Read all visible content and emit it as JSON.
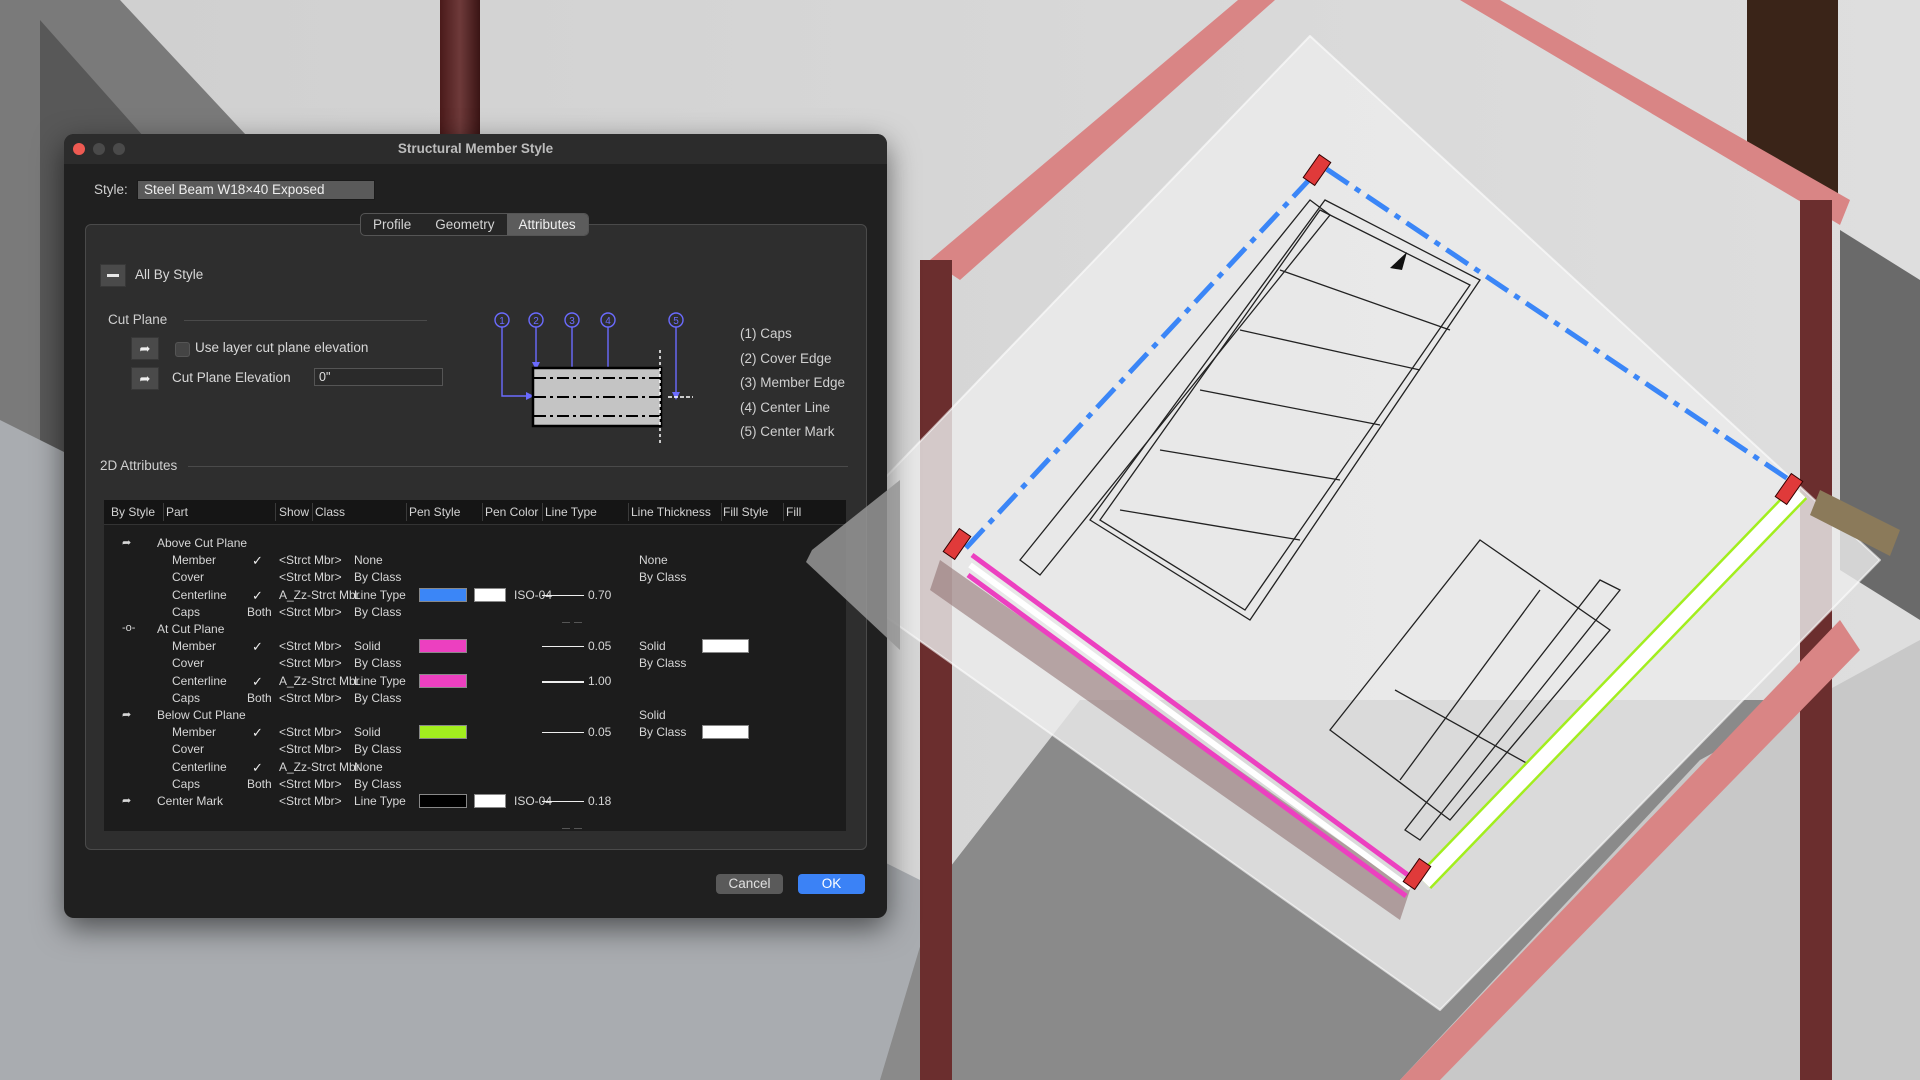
{
  "window": {
    "title": "Structural Member Style"
  },
  "style_field": {
    "label": "Style:",
    "value": "Steel Beam W18×40 Exposed"
  },
  "tabs": [
    {
      "label": "Profile",
      "active": false
    },
    {
      "label": "Geometry",
      "active": false
    },
    {
      "label": "Attributes",
      "active": true
    }
  ],
  "all_by_style": {
    "label": "All By Style"
  },
  "cut_plane": {
    "section_label": "Cut Plane",
    "use_layer_label": "Use layer cut plane elevation",
    "use_layer_checked": false,
    "elevation_label": "Cut Plane Elevation",
    "elevation_value": "0\""
  },
  "diagram": {
    "callouts": [
      "1",
      "2",
      "3",
      "4",
      "5"
    ],
    "legend": [
      "(1) Caps",
      "(2) Cover Edge",
      "(3) Member Edge",
      "(4) Center Line",
      "(5) Center Mark"
    ],
    "accent_color": "#6b6bff"
  },
  "attributes_2d": {
    "section_label": "2D Attributes",
    "columns": [
      "By Style",
      "Part",
      "Show",
      "Class",
      "Pen Style",
      "Pen Color",
      "Line Type",
      "Line Thickness",
      "Fill Style",
      "Fill"
    ],
    "rows": [
      {
        "by_style_icon": "by-style-icon",
        "part": "Above Cut Plane",
        "indent": false,
        "show": "",
        "class": "",
        "pen_style": "",
        "pen_color": "",
        "line_type_swatch": "",
        "line_type": "",
        "thickness": "",
        "fill_style": "",
        "fill": ""
      },
      {
        "by_style_icon": "",
        "part": "Member",
        "indent": true,
        "show": "✓",
        "class": "<Strct Mbr>",
        "pen_style": "None",
        "pen_color": "",
        "line_type_swatch": "",
        "line_type": "",
        "thickness": "",
        "fill_style": "None",
        "fill": ""
      },
      {
        "by_style_icon": "",
        "part": "Cover",
        "indent": true,
        "show": "",
        "class": "<Strct Mbr>",
        "pen_style": "By Class",
        "pen_color": "",
        "line_type_swatch": "",
        "line_type": "",
        "thickness": "",
        "fill_style": "By Class",
        "fill": ""
      },
      {
        "by_style_icon": "",
        "part": "Centerline",
        "indent": true,
        "show": "✓",
        "class": "A_Zz-Strct Mbr",
        "pen_style": "Line Type",
        "pen_color": "#3b86f7",
        "line_type_swatch": "#ffffff",
        "line_type": "ISO-04",
        "thickness": "0.70",
        "fill_style": "",
        "fill": ""
      },
      {
        "by_style_icon": "",
        "part": "Caps",
        "indent": true,
        "show": "Both",
        "class": "<Strct Mbr>",
        "pen_style": "By Class",
        "pen_color": "",
        "line_type_swatch": "",
        "line_type": "",
        "thickness": "",
        "fill_style": "",
        "fill": ""
      },
      {
        "by_style_icon": "at-cut-plane-icon",
        "part": "At Cut Plane",
        "indent": false,
        "show": "",
        "class": "",
        "pen_style": "",
        "pen_color": "",
        "line_type_swatch": "",
        "line_type": "",
        "thickness": "",
        "fill_style": "",
        "fill": ""
      },
      {
        "by_style_icon": "",
        "part": "Member",
        "indent": true,
        "show": "✓",
        "class": "<Strct Mbr>",
        "pen_style": "Solid",
        "pen_color": "#ec40c0",
        "line_type_swatch": "",
        "line_type": "",
        "thickness": "0.05",
        "fill_style": "Solid",
        "fill": "#ffffff"
      },
      {
        "by_style_icon": "",
        "part": "Cover",
        "indent": true,
        "show": "",
        "class": "<Strct Mbr>",
        "pen_style": "By Class",
        "pen_color": "",
        "line_type_swatch": "",
        "line_type": "",
        "thickness": "",
        "fill_style": "By Class",
        "fill": ""
      },
      {
        "by_style_icon": "",
        "part": "Centerline",
        "indent": true,
        "show": "✓",
        "class": "A_Zz-Strct Mbr",
        "pen_style": "Line Type",
        "pen_color": "#ec40c0",
        "line_type_swatch": "",
        "line_type": "",
        "thickness": "1.00",
        "fill_style": "",
        "fill": ""
      },
      {
        "by_style_icon": "",
        "part": "Caps",
        "indent": true,
        "show": "Both",
        "class": "<Strct Mbr>",
        "pen_style": "By Class",
        "pen_color": "",
        "line_type_swatch": "",
        "line_type": "",
        "thickness": "",
        "fill_style": "",
        "fill": ""
      },
      {
        "by_style_icon": "by-style-icon",
        "part": "Below Cut Plane",
        "indent": false,
        "show": "",
        "class": "",
        "pen_style": "",
        "pen_color": "",
        "line_type_swatch": "",
        "line_type": "",
        "thickness": "",
        "fill_style": "Solid",
        "fill": ""
      },
      {
        "by_style_icon": "",
        "part": "Member",
        "indent": true,
        "show": "✓",
        "class": "<Strct Mbr>",
        "pen_style": "Solid",
        "pen_color": "#a2ee1e",
        "line_type_swatch": "",
        "line_type": "",
        "thickness": "0.05",
        "fill_style": "By Class",
        "fill": "#ffffff"
      },
      {
        "by_style_icon": "",
        "part": "Cover",
        "indent": true,
        "show": "",
        "class": "<Strct Mbr>",
        "pen_style": "By Class",
        "pen_color": "",
        "line_type_swatch": "",
        "line_type": "",
        "thickness": "",
        "fill_style": "",
        "fill": ""
      },
      {
        "by_style_icon": "",
        "part": "Centerline",
        "indent": true,
        "show": "✓",
        "class": "A_Zz-Strct Mbr",
        "pen_style": "None",
        "pen_color": "",
        "line_type_swatch": "",
        "line_type": "",
        "thickness": "",
        "fill_style": "",
        "fill": ""
      },
      {
        "by_style_icon": "",
        "part": "Caps",
        "indent": true,
        "show": "Both",
        "class": "<Strct Mbr>",
        "pen_style": "By Class",
        "pen_color": "",
        "line_type_swatch": "",
        "line_type": "",
        "thickness": "",
        "fill_style": "",
        "fill": ""
      },
      {
        "by_style_icon": "by-style-icon",
        "part": "Center Mark",
        "indent": false,
        "show": "",
        "class": "<Strct Mbr>",
        "pen_style": "Line Type",
        "pen_color": "#000000",
        "line_type_swatch": "#ffffff",
        "line_type": "ISO-04",
        "thickness": "0.18",
        "fill_style": "",
        "fill": ""
      }
    ]
  },
  "buttons": {
    "cancel": "Cancel",
    "ok": "OK"
  },
  "scene_colors": {
    "steel_beam": "#d98585",
    "steel_dark": "#6b2e2e",
    "above_cut_line": "#3b86f7",
    "at_cut_line": "#ec40c0",
    "below_cut_line": "#a2ee1e",
    "cap_marker": "#e03a3a"
  }
}
